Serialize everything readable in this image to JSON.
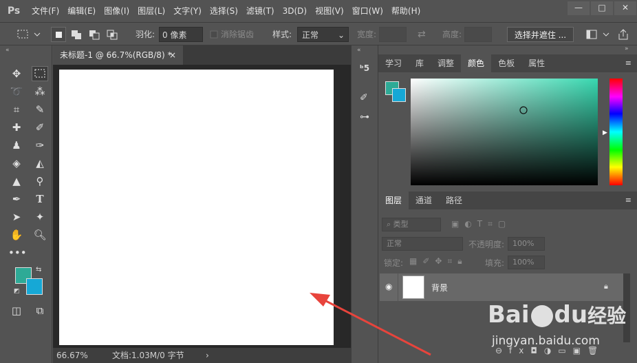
{
  "app": {
    "logo": "Ps"
  },
  "menu": {
    "items": [
      "文件(F)",
      "编辑(E)",
      "图像(I)",
      "图层(L)",
      "文字(Y)",
      "选择(S)",
      "滤镜(T)",
      "3D(D)",
      "视图(V)",
      "窗口(W)",
      "帮助(H)"
    ]
  },
  "window_controls": {
    "minimize": "—",
    "maximize": "□",
    "close": "✕"
  },
  "options": {
    "feather_label": "羽化:",
    "feather_value": "0 像素",
    "antialias_label": "消除锯齿",
    "style_label": "样式:",
    "style_value": "正常",
    "width_label": "宽度:",
    "height_label": "高度:",
    "select_mask_button": "选择并遮住 ..."
  },
  "document": {
    "tab_title": "未标题-1 @ 66.7%(RGB/8) *",
    "tab_close": "×",
    "zoom": "66.67%",
    "doc_info": "文档:1.03M/0 字节",
    "status_arrow": "›"
  },
  "color_panel": {
    "tabs": [
      "学习",
      "库",
      "调整",
      "颜色",
      "色板",
      "属性"
    ],
    "active_tab": "颜色"
  },
  "layers_panel": {
    "tabs": [
      "图层",
      "通道",
      "路径"
    ],
    "active_tab": "图层",
    "filter_label": "类型",
    "blend_mode": "正常",
    "opacity_label": "不透明度:",
    "opacity_value": "100%",
    "lock_label": "锁定:",
    "fill_label": "填充:",
    "fill_value": "100%",
    "layer_name": "背景"
  },
  "colors": {
    "foreground": "#2eaa96",
    "background": "#16a8d6",
    "picker_hue": "#38d8b0",
    "arrow": "#e8443c"
  },
  "watermark": {
    "brand": "Bai",
    "brand2": "du",
    "site_cn": "经验",
    "url": "jingyan.baidu.com"
  }
}
